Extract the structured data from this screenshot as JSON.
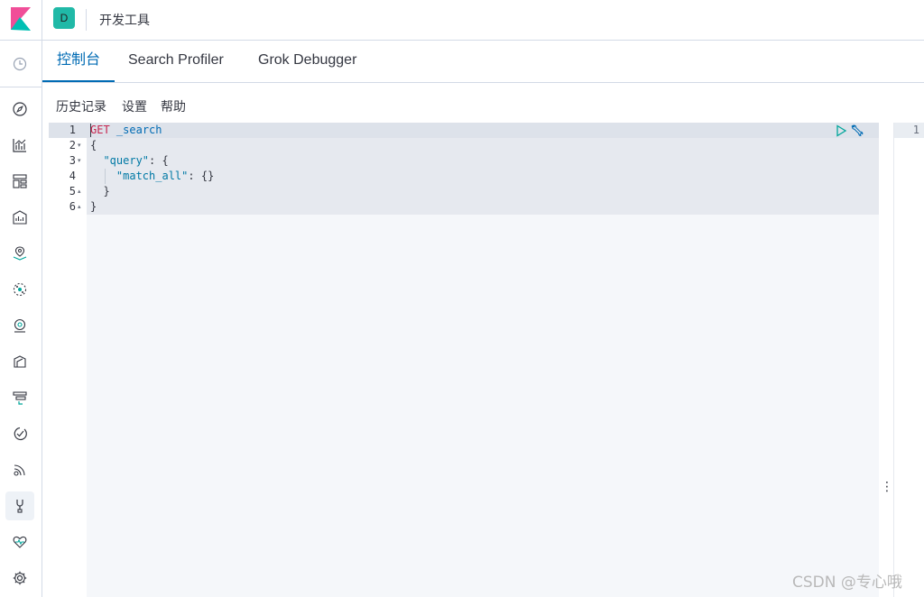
{
  "header": {
    "space_initial": "D",
    "page_title": "开发工具"
  },
  "sidebar": {
    "items": [
      {
        "icon": "clock-icon"
      },
      {
        "icon": "compass-icon"
      },
      {
        "icon": "visualize-icon"
      },
      {
        "icon": "dashboard-icon"
      },
      {
        "icon": "canvas-icon"
      },
      {
        "icon": "maps-icon"
      },
      {
        "icon": "ml-icon"
      },
      {
        "icon": "infra-icon"
      },
      {
        "icon": "logs-icon"
      },
      {
        "icon": "apm-icon"
      },
      {
        "icon": "uptime-icon"
      },
      {
        "icon": "siem-icon"
      },
      {
        "icon": "devtools-icon",
        "active": true
      },
      {
        "icon": "monitoring-icon"
      },
      {
        "icon": "gear-icon"
      }
    ]
  },
  "tabs": [
    {
      "label": "控制台",
      "active": true
    },
    {
      "label": "Search Profiler"
    },
    {
      "label": "Grok Debugger"
    }
  ],
  "menu": {
    "history": "历史记录",
    "settings": "设置",
    "help": "帮助"
  },
  "editor": {
    "lines": [
      {
        "num": "1",
        "fold": ""
      },
      {
        "num": "2",
        "fold": "▾"
      },
      {
        "num": "3",
        "fold": "▾"
      },
      {
        "num": "4",
        "fold": ""
      },
      {
        "num": "5",
        "fold": "▴"
      },
      {
        "num": "6",
        "fold": "▴"
      }
    ],
    "method": "GET",
    "path": "_search",
    "open_brace": "{",
    "query_key": "\"query\"",
    "query_rest": ": {",
    "match_all_key": "\"match_all\"",
    "match_all_rest": ": {}",
    "inner_close": "}",
    "outer_close": "}"
  },
  "output": {
    "line_number": "1"
  },
  "watermark": "CSDN @专心哦",
  "colors": {
    "accent": "#006bb4",
    "method": "#c7254e",
    "avatar": "#20b9a7",
    "action_icons": "#00a69b"
  }
}
